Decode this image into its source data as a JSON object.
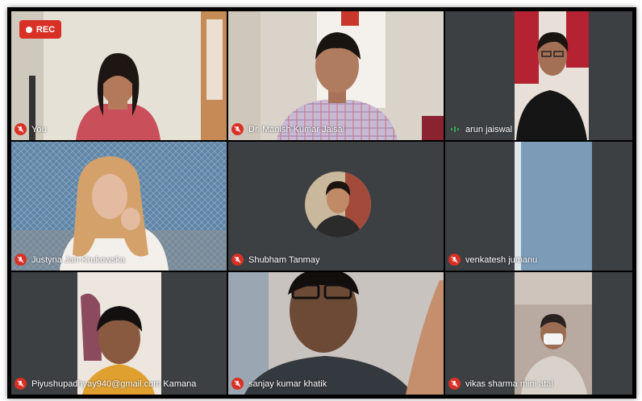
{
  "recording": {
    "label": "REC"
  },
  "participants": [
    {
      "name": "You",
      "muted": true
    },
    {
      "name": "Dr. Manish Kumar Jaisal",
      "muted": true
    },
    {
      "name": "arun jaiswal",
      "muted": false,
      "speaking": true
    },
    {
      "name": "Justyna Jan-Krukowska",
      "muted": true
    },
    {
      "name": "Shubham Tanmay",
      "muted": true
    },
    {
      "name": "venkatesh jumanu",
      "muted": true
    },
    {
      "name": "Piyushupadhyay940@gmail.com Kamana",
      "muted": true
    },
    {
      "name": "sanjay kumar khatik",
      "muted": true
    },
    {
      "name": "vikas sharma mini atal",
      "muted": true
    }
  ],
  "colors": {
    "muted_badge": "#d93025",
    "speaking": "#34a853",
    "tile_bg": "#3c4043"
  },
  "icons": {
    "muted": "mic-off-icon",
    "speaking": "audio-level-icon",
    "recording": "record-dot-icon"
  }
}
